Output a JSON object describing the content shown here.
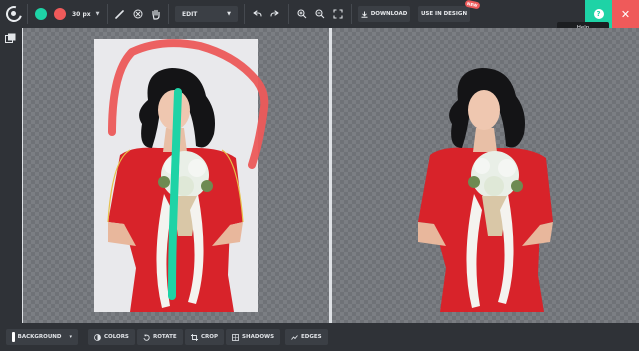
{
  "toolbar": {
    "brush_size": "30 px",
    "mode": "EDIT",
    "download_label": "DOWNLOAD",
    "design_label": "USE IN DESIGN",
    "badge": "NEW",
    "help_tooltip": "Help"
  },
  "bottom": {
    "background_label": "BACKGROUND",
    "colors_label": "COLORS",
    "rotate_label": "ROTATE",
    "crop_label": "CROP",
    "shadows_label": "SHADOWS",
    "edges_label": "EDGES"
  },
  "colors": {
    "keep_brush": "#1ed3a6",
    "remove_brush": "#ef5a5a",
    "accent_help": "#1ed3a6",
    "accent_close": "#ef5a5a"
  }
}
